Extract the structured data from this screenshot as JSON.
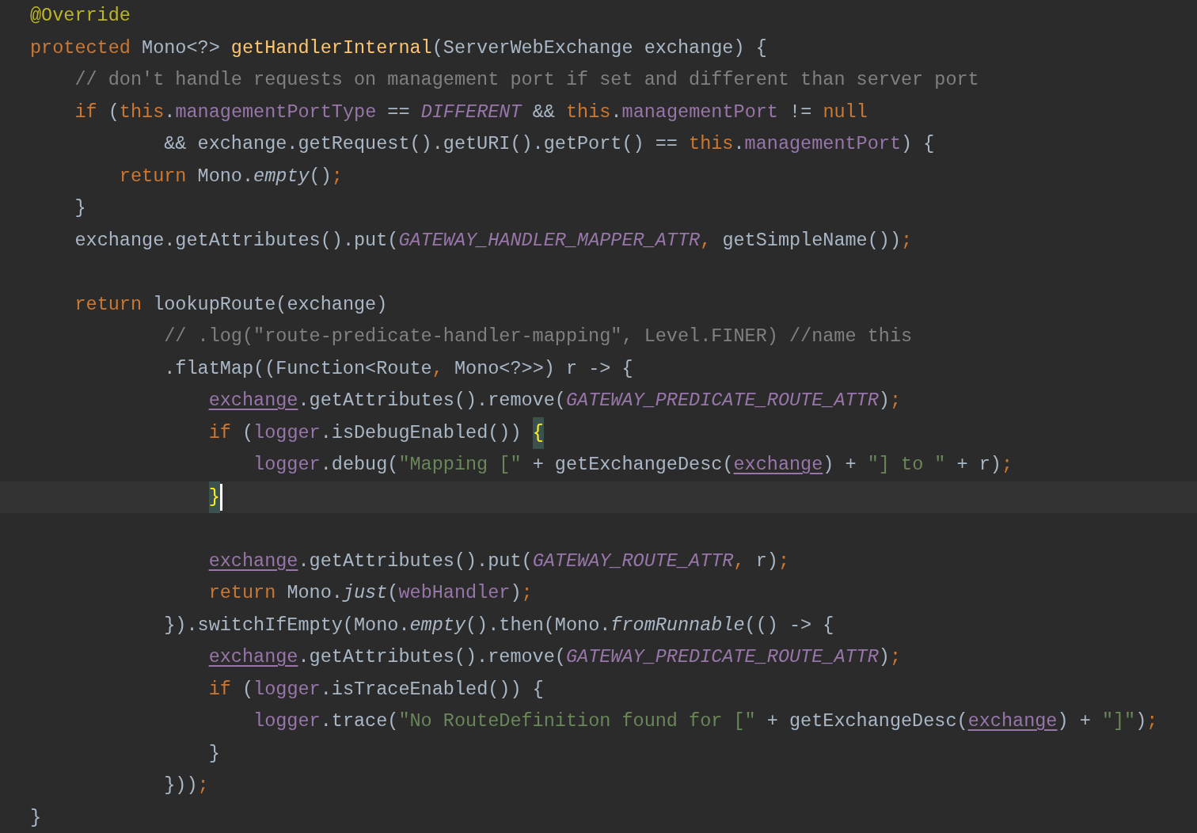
{
  "editor": {
    "lines": [
      {
        "current": false,
        "tokens": [
          {
            "text": "@Override",
            "kind": "annotation"
          }
        ]
      },
      {
        "current": false,
        "tokens": [
          {
            "text": "protected",
            "kind": "keyword"
          },
          {
            "text": " Mono<?> ",
            "kind": "plain"
          },
          {
            "text": "getHandlerInternal",
            "kind": "declaration"
          },
          {
            "text": "(ServerWebExchange exchange) {",
            "kind": "plain"
          }
        ]
      },
      {
        "current": false,
        "tokens": [
          {
            "text": "    // don't handle requests on management port if set and different than server port",
            "kind": "comment"
          }
        ]
      },
      {
        "current": false,
        "tokens": [
          {
            "text": "    if",
            "kind": "keyword"
          },
          {
            "text": " (",
            "kind": "plain"
          },
          {
            "text": "this",
            "kind": "keyword"
          },
          {
            "text": ".",
            "kind": "plain"
          },
          {
            "text": "managementPortType",
            "kind": "field"
          },
          {
            "text": " == ",
            "kind": "plain"
          },
          {
            "text": "DIFFERENT",
            "kind": "constant"
          },
          {
            "text": " && ",
            "kind": "plain"
          },
          {
            "text": "this",
            "kind": "keyword"
          },
          {
            "text": ".",
            "kind": "plain"
          },
          {
            "text": "managementPort",
            "kind": "field"
          },
          {
            "text": " != ",
            "kind": "plain"
          },
          {
            "text": "null",
            "kind": "keyword"
          }
        ]
      },
      {
        "current": false,
        "tokens": [
          {
            "text": "            && exchange.getRequest().getURI().getPort() == ",
            "kind": "plain"
          },
          {
            "text": "this",
            "kind": "keyword"
          },
          {
            "text": ".",
            "kind": "plain"
          },
          {
            "text": "managementPort",
            "kind": "field"
          },
          {
            "text": ") {",
            "kind": "plain"
          }
        ]
      },
      {
        "current": false,
        "tokens": [
          {
            "text": "        return",
            "kind": "keyword"
          },
          {
            "text": " Mono.",
            "kind": "plain"
          },
          {
            "text": "empty",
            "kind": "static"
          },
          {
            "text": "()",
            "kind": "plain"
          },
          {
            "text": ";",
            "kind": "keyword"
          }
        ]
      },
      {
        "current": false,
        "tokens": [
          {
            "text": "    }",
            "kind": "plain"
          }
        ]
      },
      {
        "current": false,
        "tokens": [
          {
            "text": "    exchange.getAttributes().put(",
            "kind": "plain"
          },
          {
            "text": "GATEWAY_HANDLER_MAPPER_ATTR",
            "kind": "constant"
          },
          {
            "text": ",",
            "kind": "keyword"
          },
          {
            "text": " getSimpleName())",
            "kind": "plain"
          },
          {
            "text": ";",
            "kind": "keyword"
          }
        ]
      },
      {
        "current": false
      },
      {
        "current": false,
        "tokens": [
          {
            "text": "    return",
            "kind": "keyword"
          },
          {
            "text": " lookupRoute(exchange)",
            "kind": "plain"
          }
        ]
      },
      {
        "current": false,
        "tokens": [
          {
            "text": "            // .log(\"route-predicate-handler-mapping\", Level.FINER) //name this",
            "kind": "comment"
          }
        ]
      },
      {
        "current": false,
        "tokens": [
          {
            "text": "            .flatMap((Function<Route",
            "kind": "plain"
          },
          {
            "text": ",",
            "kind": "keyword"
          },
          {
            "text": " Mono<?>>) r -> {",
            "kind": "plain"
          }
        ]
      },
      {
        "current": false,
        "tokens": [
          {
            "text": "                exchange",
            "kind": "captured"
          },
          {
            "text": ".getAttributes().remove(",
            "kind": "plain"
          },
          {
            "text": "GATEWAY_PREDICATE_ROUTE_ATTR",
            "kind": "constant"
          },
          {
            "text": ")",
            "kind": "plain"
          },
          {
            "text": ";",
            "kind": "keyword"
          }
        ]
      },
      {
        "current": false,
        "tokens": [
          {
            "text": "                if",
            "kind": "keyword"
          },
          {
            "text": " (",
            "kind": "plain"
          },
          {
            "text": "logger",
            "kind": "field"
          },
          {
            "text": ".isDebugEnabled()) ",
            "kind": "plain"
          },
          {
            "text": "{",
            "kind": "brace-match"
          }
        ]
      },
      {
        "current": false,
        "tokens": [
          {
            "text": "                    logger",
            "kind": "field"
          },
          {
            "text": ".debug(",
            "kind": "plain"
          },
          {
            "text": "\"Mapping [\"",
            "kind": "string"
          },
          {
            "text": " + getExchangeDesc(",
            "kind": "plain"
          },
          {
            "text": "exchange",
            "kind": "captured"
          },
          {
            "text": ") + ",
            "kind": "plain"
          },
          {
            "text": "\"] to \"",
            "kind": "string"
          },
          {
            "text": " + r)",
            "kind": "plain"
          },
          {
            "text": ";",
            "kind": "keyword"
          }
        ]
      },
      {
        "current": true,
        "tokens": [
          {
            "text": "                }",
            "kind": "brace-match"
          }
        ]
      },
      {
        "current": false
      },
      {
        "current": false,
        "tokens": [
          {
            "text": "                exchange",
            "kind": "captured"
          },
          {
            "text": ".getAttributes().put(",
            "kind": "plain"
          },
          {
            "text": "GATEWAY_ROUTE_ATTR",
            "kind": "constant"
          },
          {
            "text": ",",
            "kind": "keyword"
          },
          {
            "text": " r)",
            "kind": "plain"
          },
          {
            "text": ";",
            "kind": "keyword"
          }
        ]
      },
      {
        "current": false,
        "tokens": [
          {
            "text": "                return",
            "kind": "keyword"
          },
          {
            "text": " Mono.",
            "kind": "plain"
          },
          {
            "text": "just",
            "kind": "static"
          },
          {
            "text": "(",
            "kind": "plain"
          },
          {
            "text": "webHandler",
            "kind": "field"
          },
          {
            "text": ")",
            "kind": "plain"
          },
          {
            "text": ";",
            "kind": "keyword"
          }
        ]
      },
      {
        "current": false,
        "tokens": [
          {
            "text": "            }).switchIfEmpty(Mono.",
            "kind": "plain"
          },
          {
            "text": "empty",
            "kind": "static"
          },
          {
            "text": "().then(Mono.",
            "kind": "plain"
          },
          {
            "text": "fromRunnable",
            "kind": "static"
          },
          {
            "text": "(() -> {",
            "kind": "plain"
          }
        ]
      },
      {
        "current": false,
        "tokens": [
          {
            "text": "                exchange",
            "kind": "captured"
          },
          {
            "text": ".getAttributes().remove(",
            "kind": "plain"
          },
          {
            "text": "GATEWAY_PREDICATE_ROUTE_ATTR",
            "kind": "constant"
          },
          {
            "text": ")",
            "kind": "plain"
          },
          {
            "text": ";",
            "kind": "keyword"
          }
        ]
      },
      {
        "current": false,
        "tokens": [
          {
            "text": "                if",
            "kind": "keyword"
          },
          {
            "text": " (",
            "kind": "plain"
          },
          {
            "text": "logger",
            "kind": "field"
          },
          {
            "text": ".isTraceEnabled()) {",
            "kind": "plain"
          }
        ]
      },
      {
        "current": false,
        "tokens": [
          {
            "text": "                    logger",
            "kind": "field"
          },
          {
            "text": ".trace(",
            "kind": "plain"
          },
          {
            "text": "\"No RouteDefinition found for [\"",
            "kind": "string"
          },
          {
            "text": " + getExchangeDesc(",
            "kind": "plain"
          },
          {
            "text": "exchange",
            "kind": "captured"
          },
          {
            "text": ") + ",
            "kind": "plain"
          },
          {
            "text": "\"]\"",
            "kind": "string"
          },
          {
            "text": ")",
            "kind": "plain"
          },
          {
            "text": ";",
            "kind": "keyword"
          }
        ]
      },
      {
        "current": false,
        "tokens": [
          {
            "text": "                }",
            "kind": "plain"
          }
        ]
      },
      {
        "current": false,
        "tokens": [
          {
            "text": "            }))",
            "kind": "plain"
          },
          {
            "text": ";",
            "kind": "keyword"
          }
        ]
      },
      {
        "current": false,
        "tokens": [
          {
            "text": "}",
            "kind": "plain"
          }
        ]
      }
    ]
  }
}
